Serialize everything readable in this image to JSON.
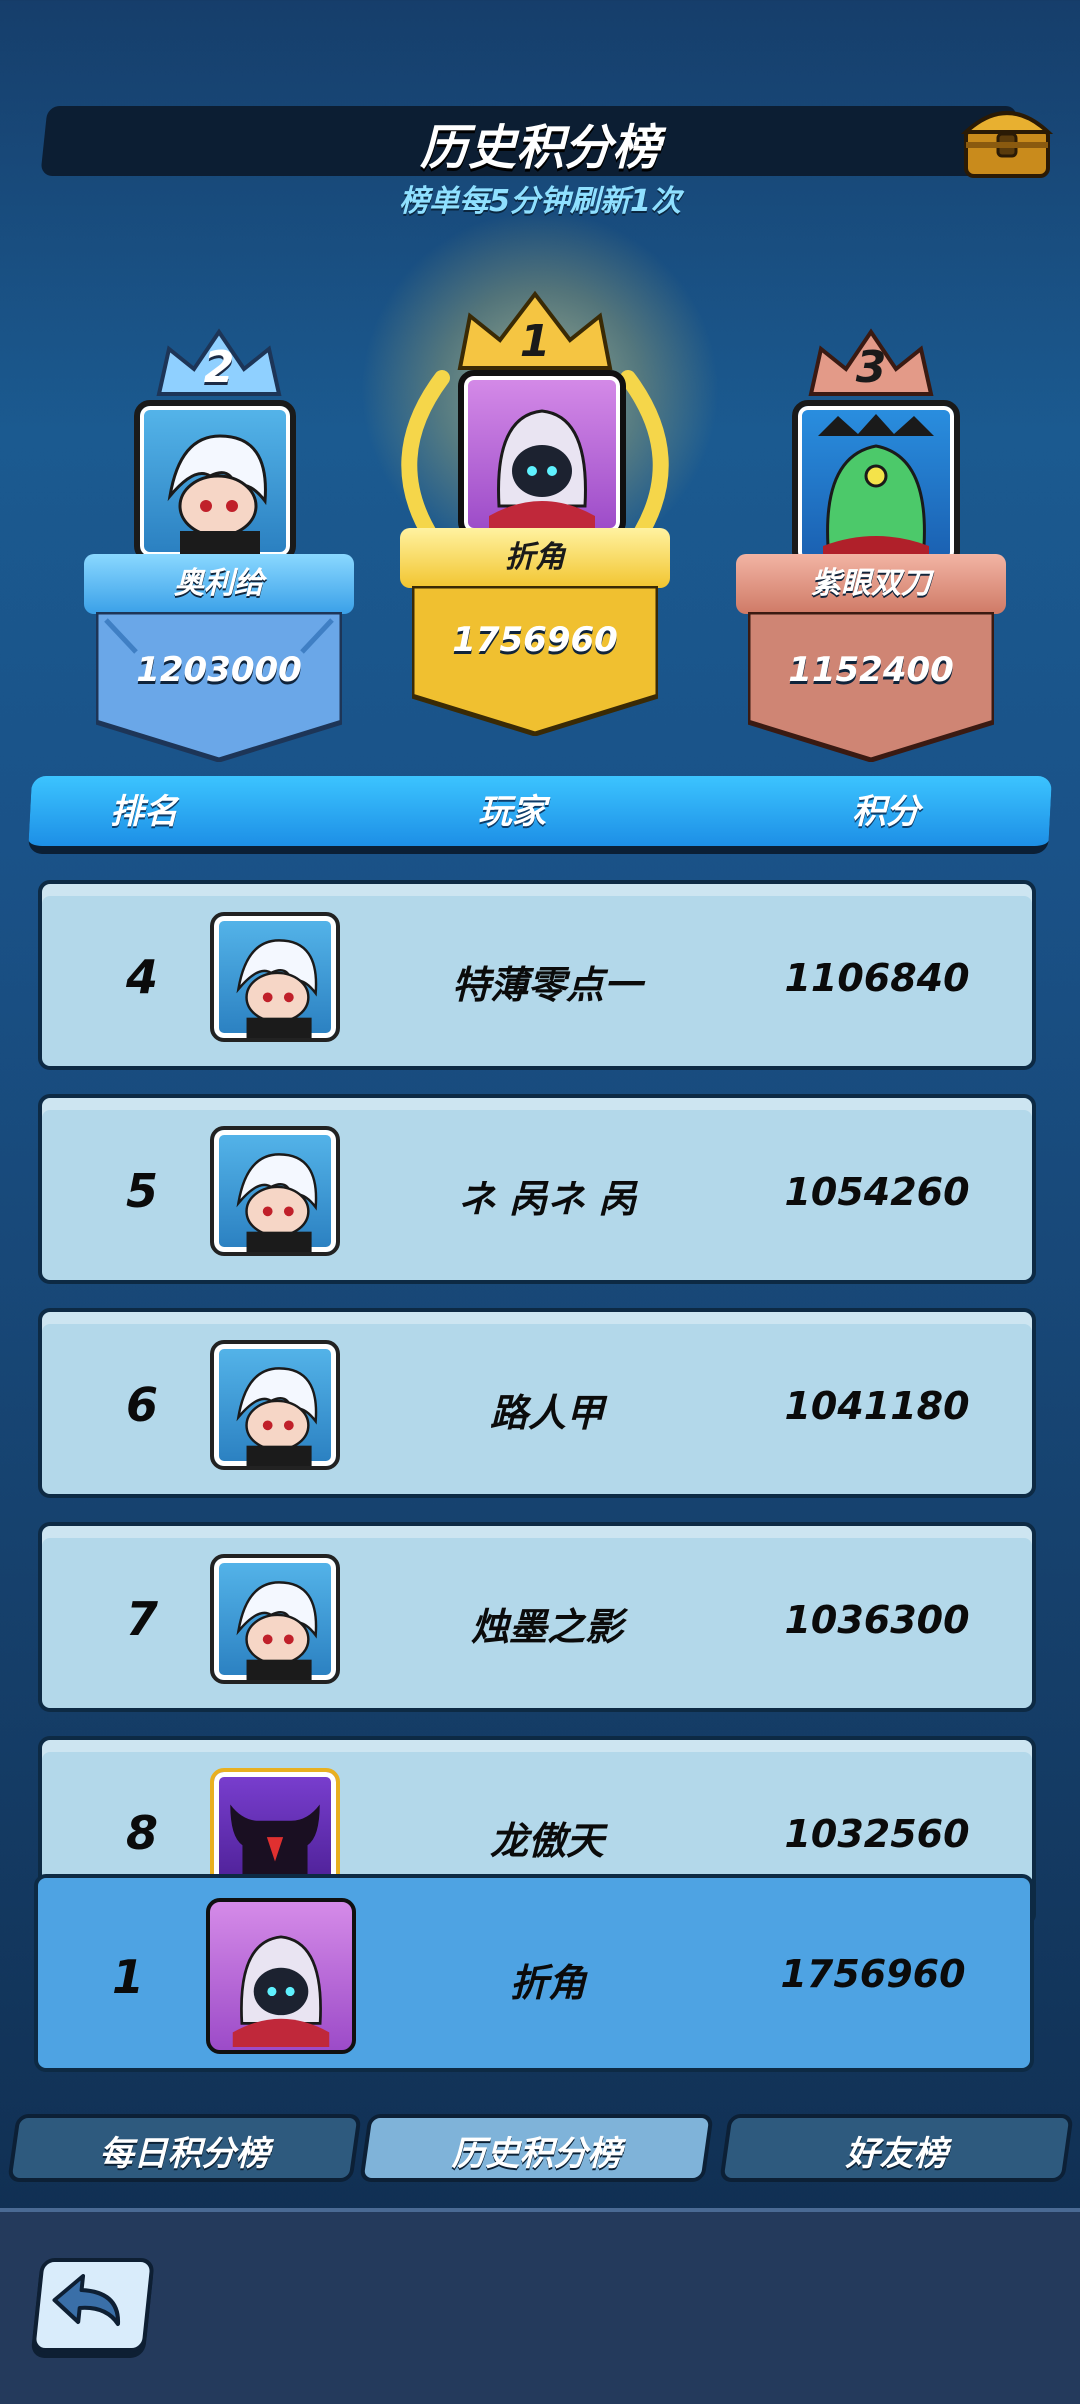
{
  "header": {
    "title": "历史积分榜",
    "subtitle": "榜单每5分钟刷新1次"
  },
  "podium": [
    {
      "rank": "2",
      "name": "奥利给",
      "score": "1203000"
    },
    {
      "rank": "1",
      "name": "折角",
      "score": "1756960"
    },
    {
      "rank": "3",
      "name": "紫眼双刀",
      "score": "1152400"
    }
  ],
  "table": {
    "headers": {
      "rank": "排名",
      "player": "玩家",
      "score": "积分"
    },
    "rows": [
      {
        "rank": "4",
        "name": "特薄零点一",
        "score": "1106840"
      },
      {
        "rank": "5",
        "name": "ネ 呙ネ 呙",
        "score": "1054260"
      },
      {
        "rank": "6",
        "name": "路人甲",
        "score": "1041180"
      },
      {
        "rank": "7",
        "name": "烛墨之影",
        "score": "1036300"
      },
      {
        "rank": "8",
        "name": "龙傲天",
        "score": "1032560"
      }
    ]
  },
  "self_row": {
    "rank": "1",
    "name": "折角",
    "score": "1756960"
  },
  "tabs": [
    {
      "label": "每日积分榜",
      "active": false
    },
    {
      "label": "历史积分榜",
      "active": true
    },
    {
      "label": "好友榜",
      "active": false
    }
  ],
  "colors": {
    "gold": "#f5c542",
    "silver_blue": "#7fc3f5",
    "bronze": "#d88b78",
    "row_bg": "#b3d8ea",
    "self_row_bg": "#4ea3e3"
  }
}
